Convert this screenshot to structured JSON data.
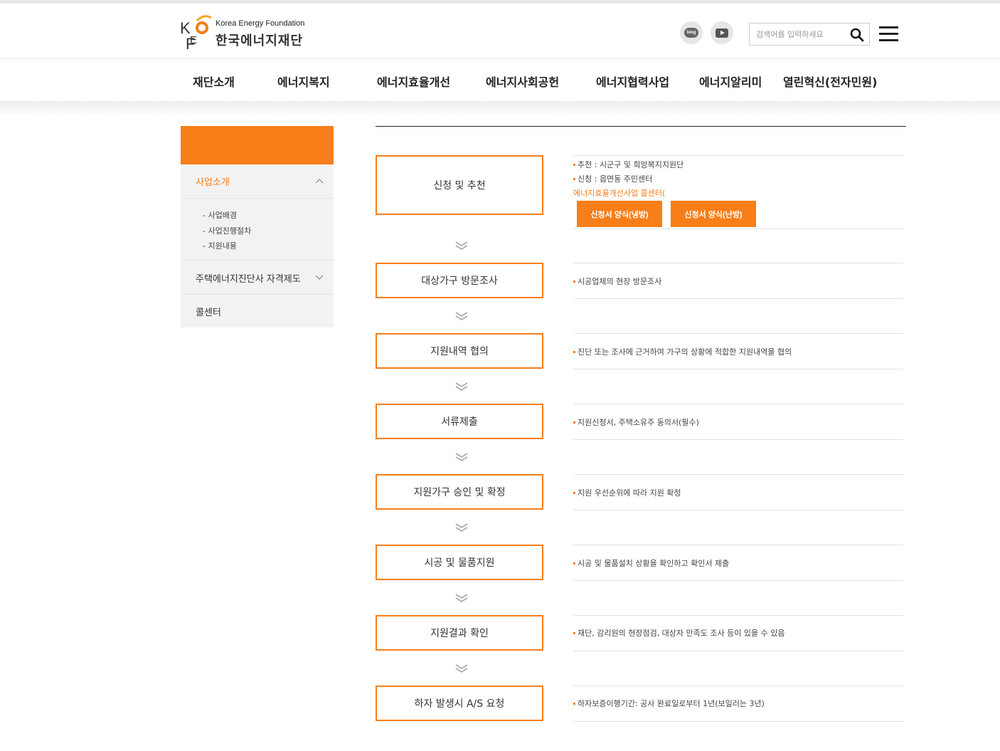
{
  "header": {
    "logo_en": "Korea Energy Foundation",
    "logo_ko": "한국에너지재단",
    "blog_label": "blog",
    "search_placeholder": "검색어를 입력하세요"
  },
  "nav": [
    "재단소개",
    "에너지복지",
    "에너지효율개선",
    "에너지사회공헌",
    "에너지협력사업",
    "에너지알리미",
    "열린혁신(전자민원)"
  ],
  "sidebar": {
    "header_title": "",
    "main_item": "사업소개",
    "sub_items": [
      "- 사업배경",
      "- 사업진행절차",
      "- 지원내용"
    ],
    "item2": "주택에너지진단사 자격제도",
    "item3": "콜센터"
  },
  "steps": [
    {
      "title": "신청 및 추천",
      "desc": [
        "추천 : 시군구 및 희망복지지원단",
        "신청 : 읍면동 주민센터"
      ],
      "extra": "에너지효율개선사업 콜센터(",
      "buttons": [
        "신청서 양식(냉방)",
        "신청서 양식(난방)"
      ]
    },
    {
      "title": "대상가구 방문조사",
      "desc": [
        "시공업체의 현장 방문조사"
      ]
    },
    {
      "title": "지원내역 협의",
      "desc": [
        "진단 또는 조사에 근거하여 가구의 상황에 적합한 지원내역을 협의"
      ]
    },
    {
      "title": "서류제출",
      "desc": [
        "지원신청서, 주택소유주 동의서(필수)"
      ]
    },
    {
      "title": "지원가구 승인 및 확정",
      "desc": [
        "지원 우선순위에 따라 지원 확정"
      ]
    },
    {
      "title": "시공 및 물품지원",
      "desc": [
        "시공 및 물품설치 상황을 확인하고 확인서 제출"
      ]
    },
    {
      "title": "지원결과 확인",
      "desc": [
        "재단, 감리원의 현장점검, 대상자 만족도 조사 등이 있을 수 있음"
      ]
    },
    {
      "title": "하자 발생시 A/S 요청",
      "desc": [
        "하자보증이행기간: 공사 완료일로부터 1년(보일러는 3년)"
      ]
    }
  ],
  "colors": {
    "accent": "#f77e19",
    "sidebar_bg": "#f2f2f2"
  }
}
